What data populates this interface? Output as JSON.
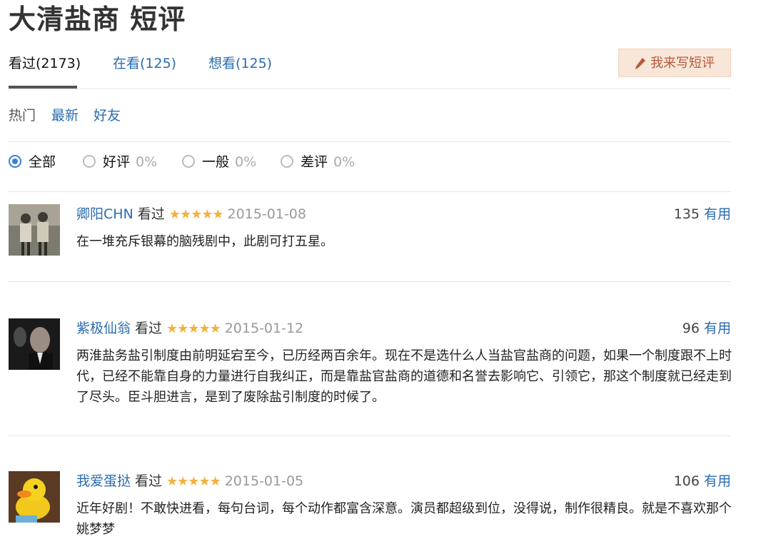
{
  "page": {
    "title": "大清盐商 短评"
  },
  "tabs": [
    {
      "label": "看过(2173)"
    },
    {
      "label": "在看(125)"
    },
    {
      "label": "想看(125)"
    }
  ],
  "write_button": {
    "label": "我来写短评",
    "icon": "pencil-icon"
  },
  "sort": [
    {
      "label": "热门"
    },
    {
      "label": "最新"
    },
    {
      "label": "好友"
    }
  ],
  "filters": [
    {
      "label": "全部",
      "pct": "",
      "selected": true
    },
    {
      "label": "好评",
      "pct": "0%",
      "selected": false
    },
    {
      "label": "一般",
      "pct": "0%",
      "selected": false
    },
    {
      "label": "差评",
      "pct": "0%",
      "selected": false
    }
  ],
  "reviews": [
    {
      "user": "卿阳CHN",
      "status": "看过",
      "rating": 5,
      "stars": "★★★★★",
      "date": "2015-01-08",
      "votes": "135",
      "useful_label": "有用",
      "content": "在一堆充斥银幕的脑残剧中，此剧可打五星。"
    },
    {
      "user": "紫极仙翁",
      "status": "看过",
      "rating": 5,
      "stars": "★★★★★",
      "date": "2015-01-12",
      "votes": "96",
      "useful_label": "有用",
      "content": "两淮盐务盐引制度由前明延宕至今，已历经两百余年。现在不是选什么人当盐官盐商的问题，如果一个制度跟不上时代，已经不能靠自身的力量进行自我纠正，而是靠盐官盐商的道德和名誉去影响它、引领它，那这个制度就已经走到了尽头。臣斗胆进言，是到了废除盐引制度的时候了。"
    },
    {
      "user": "我爱蛋挞",
      "status": "看过",
      "rating": 5,
      "stars": "★★★★★",
      "date": "2015-01-05",
      "votes": "106",
      "useful_label": "有用",
      "content": "近年好剧！不敢快进看，每句台词，每个动作都富含深意。演员都超级到位，没得说，制作很精良。就是不喜欢那个姚梦梦"
    }
  ],
  "colors": {
    "link": "#2b6cb0",
    "star": "#f4b13c",
    "button_bg": "#f8e6d8",
    "button_text": "#b5593c"
  }
}
